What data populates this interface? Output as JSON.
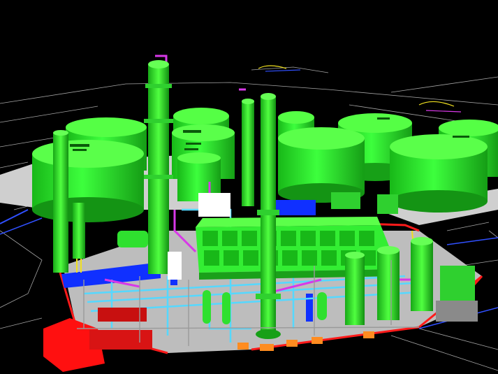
{
  "scene": {
    "background": "#000000",
    "colors": {
      "equipment_green": "#22ee22",
      "equipment_green_light": "#66ff55",
      "equipment_green_dark": "#16a816",
      "slab_gray": "#c8c8c8",
      "pipe_red": "#ff1a1a",
      "pipe_blue": "#1030ff",
      "pipe_cyan": "#55d8ff",
      "pipe_magenta": "#d838e8",
      "pipe_yellow": "#f0e020",
      "cad_linework": "#dcdcdc"
    },
    "objects": [
      "storage-tank",
      "distillation-column",
      "flare-stack",
      "air-cooler-bank",
      "pipe-rack",
      "vertical-vessel",
      "horizontal-drum",
      "compressor-skid",
      "concrete-pad",
      "site-plan-linework"
    ]
  }
}
